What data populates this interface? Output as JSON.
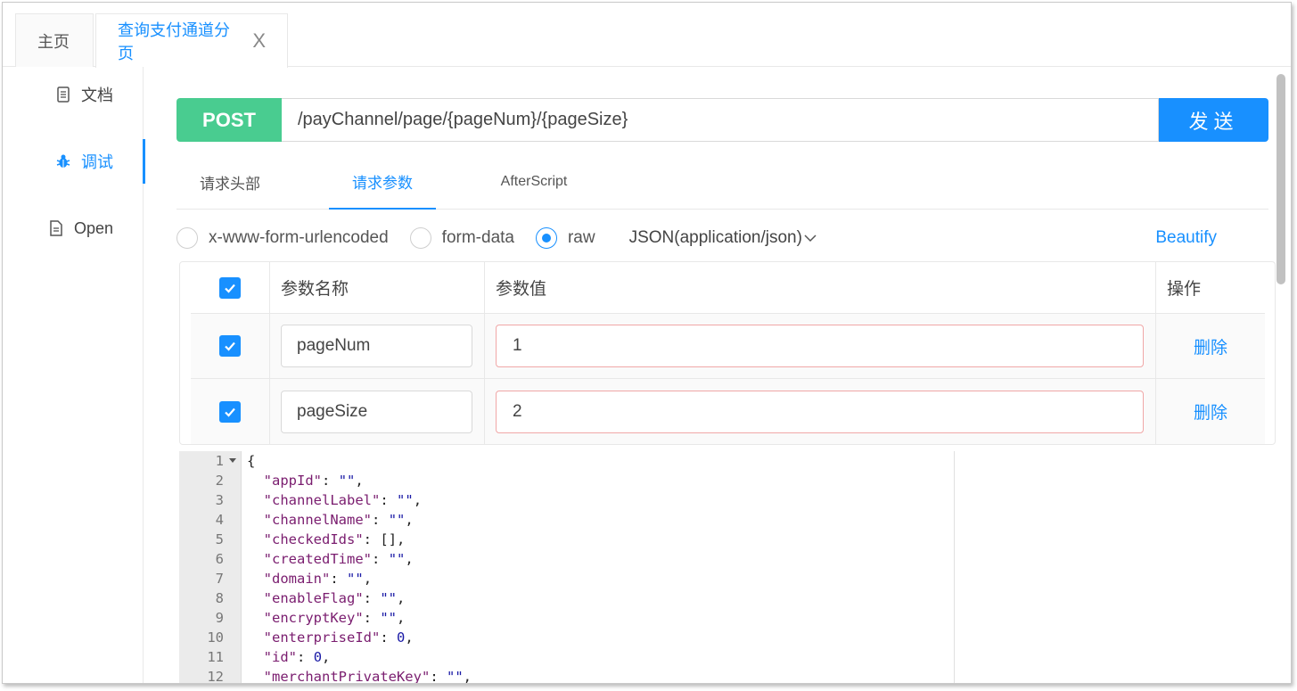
{
  "tabs": {
    "home_label": "主页",
    "active_label": "查询支付通道分页",
    "close_symbol": "X"
  },
  "nav": {
    "doc": "文档",
    "debug": "调试",
    "open": "Open"
  },
  "request": {
    "method": "POST",
    "url": "/payChannel/page/{pageNum}/{pageSize}",
    "send_label": "发送"
  },
  "subtabs": {
    "headers": "请求头部",
    "params": "请求参数",
    "after": "AfterScript"
  },
  "body_types": {
    "urlencoded": "x-www-form-urlencoded",
    "formdata": "form-data",
    "raw": "raw",
    "selected": "raw",
    "content_type": "JSON(application/json)",
    "beautify": "Beautify"
  },
  "params_table": {
    "col_name": "参数名称",
    "col_value": "参数值",
    "col_op": "操作",
    "rows": [
      {
        "name": "pageNum",
        "value": "1",
        "action": "删除",
        "checked": true
      },
      {
        "name": "pageSize",
        "value": "2",
        "action": "删除",
        "checked": true
      }
    ]
  },
  "editor": {
    "line_numbers": [
      "1",
      "2",
      "3",
      "4",
      "5",
      "6",
      "7",
      "8",
      "9",
      "10",
      "11",
      "12"
    ],
    "lines": [
      "{",
      "  \"appId\": \"\",",
      "  \"channelLabel\": \"\",",
      "  \"channelName\": \"\",",
      "  \"checkedIds\": [],",
      "  \"createdTime\": \"\",",
      "  \"domain\": \"\",",
      "  \"enableFlag\": \"\",",
      "  \"encryptKey\": \"\",",
      "  \"enterpriseId\": 0,",
      "  \"id\": 0,",
      "  \"merchantPrivateKey\": \"\","
    ]
  },
  "colors": {
    "accent": "#1890ff",
    "method_post": "#49cc90"
  }
}
